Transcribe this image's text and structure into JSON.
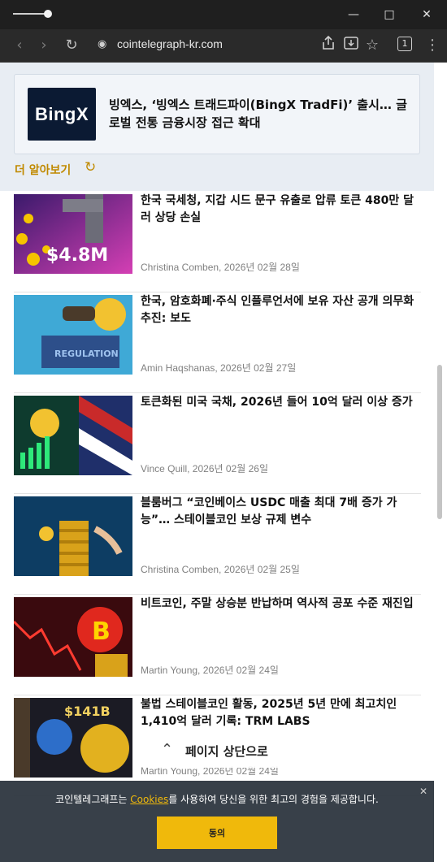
{
  "browser": {
    "url": "cointelegraph-kr.com",
    "tab_count": "1"
  },
  "promo": {
    "logo_text": "BingX",
    "title": "빙엑스, ‘빙엑스 트래드파이(BingX TradFi)’ 출시… 글로벌 전통 금융시장 접근 확대"
  },
  "more_label": "더 알아보기",
  "articles": [
    {
      "title": "한국 국세청, 지갑 시드 문구 유출로 압류 토큰 480만 달러 상당 손실",
      "meta": "Christina Comben, 2026년 02월 28일",
      "thumb_text": "$4.8M"
    },
    {
      "title": "한국, 암호화폐·주식 인플루언서에 보유 자산 공개 의무화 추진: 보도",
      "meta": "Amin Haqshanas, 2026년 02월 27일",
      "thumb_text": "REGULATION"
    },
    {
      "title": "토큰화된 미국 국채, 2026년 들어 10억 달러 이상 증가",
      "meta": "Vince Quill, 2026년 02월 26일",
      "thumb_text": ""
    },
    {
      "title": "블룸버그 “코인베이스 USDC 매출 최대 7배 증가 가능”… 스테이블코인 보상 규제 변수",
      "meta": "Christina Comben, 2026년 02월 25일",
      "thumb_text": ""
    },
    {
      "title": "비트코인, 주말 상승분 반납하며 역사적 공포 수준 재진입",
      "meta": "Martin Young, 2026년 02월 24일",
      "thumb_text": ""
    },
    {
      "title": "불법 스테이블코인 활동, 2025년 5년 만에 최고치인 1,410억 달러 기록: TRM LABS",
      "meta": "Martin Young, 2026년 02월 24일",
      "thumb_text": "$141B"
    }
  ],
  "to_top_label": "페이지 상단으로",
  "cookie": {
    "text_before": "코인텔레그래프는 ",
    "link": "Cookies",
    "text_after": "를 사용하여 당신을 위한 최고의 경험을 제공합니다.",
    "accept_label": "동의"
  },
  "colors": {
    "accent": "#f0b90b",
    "link_gold": "#c08a00",
    "cookie_bg": "#2c343e"
  }
}
